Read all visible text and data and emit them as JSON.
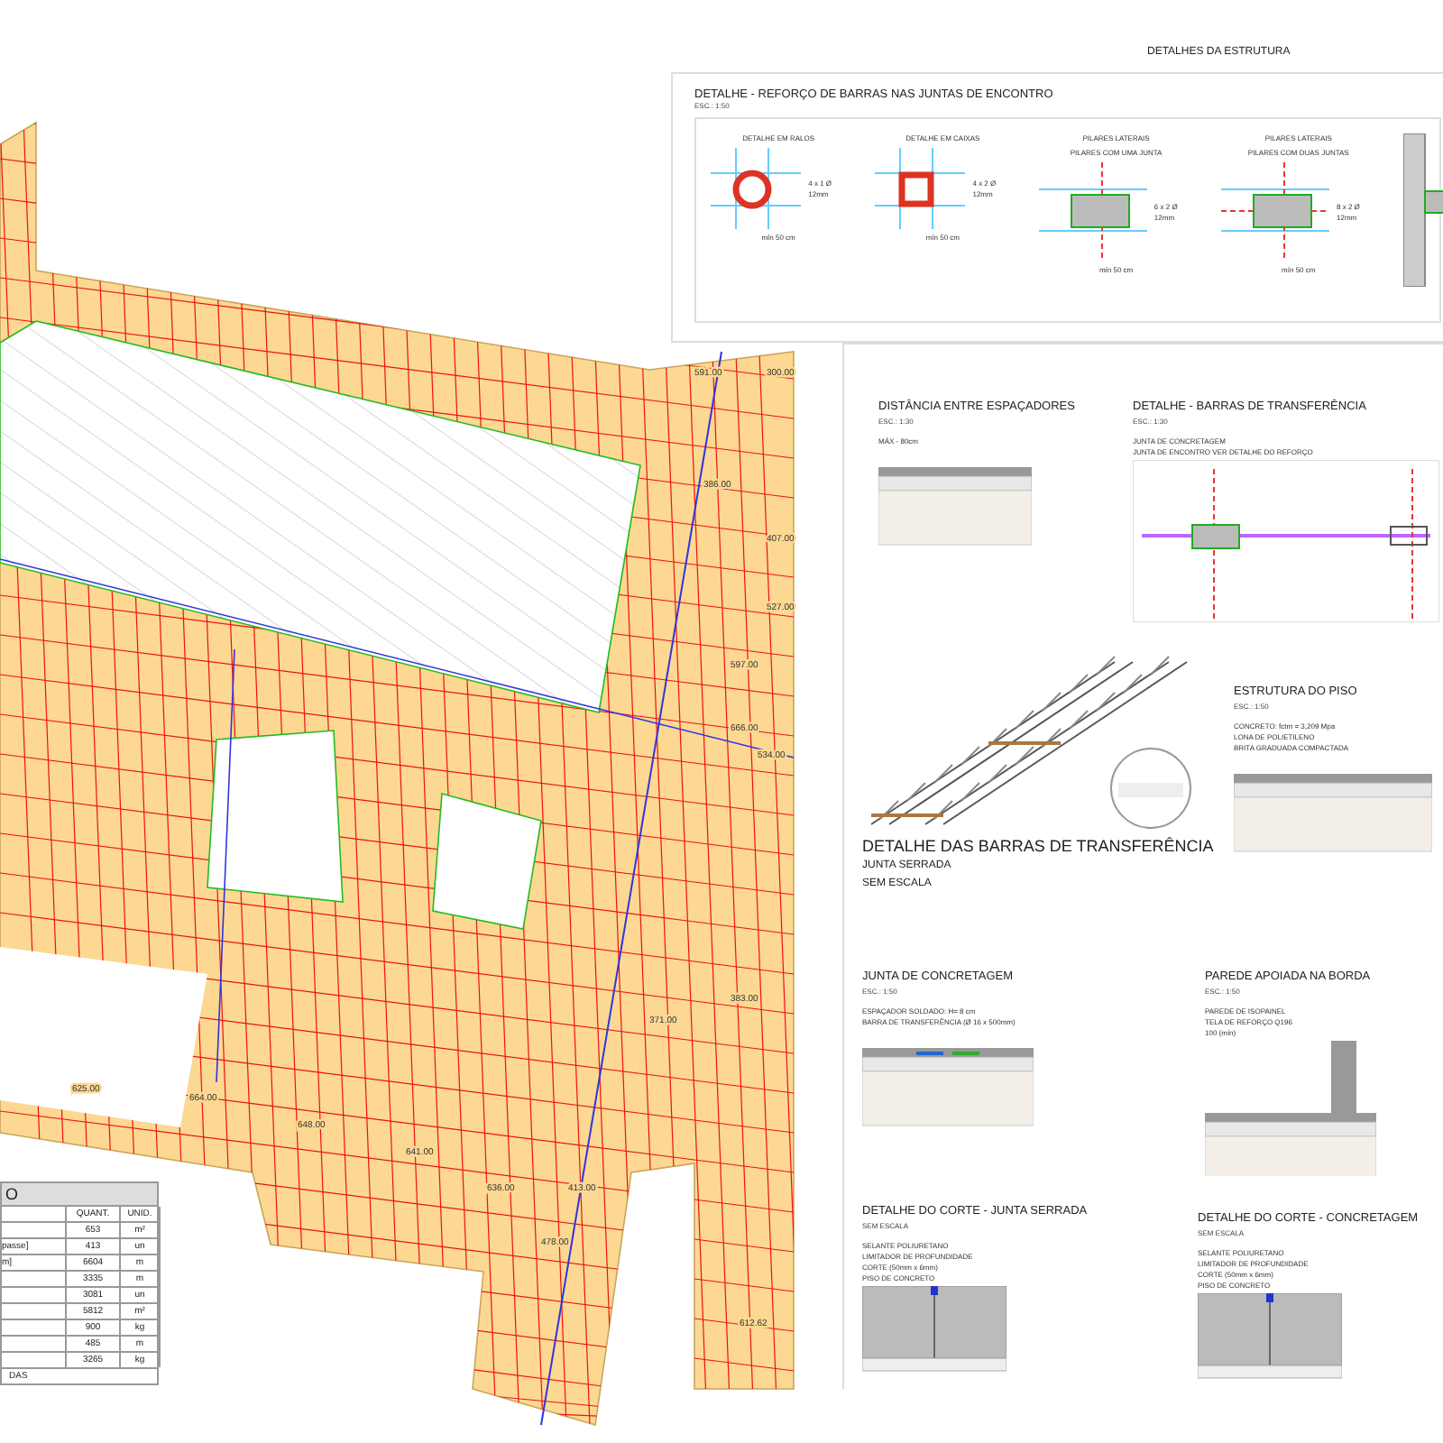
{
  "sheet_title": "DETALHES DA ESTRUTURA",
  "reinforcement": {
    "title": "DETALHE - REFORÇO DE BARRAS NAS JUNTAS DE ENCONTRO",
    "scale": "ESC.: 1:50",
    "details": [
      {
        "kind": "round",
        "label": "DETALHE EM RALOS",
        "note": "4 x 1 Ø 12mm",
        "dim": "mín 50 cm"
      },
      {
        "kind": "square",
        "label": "DETALHE EM CAIXAS",
        "note": "4 x 2 Ø 12mm",
        "dim": "mín 50 cm"
      },
      {
        "kind": "one_joint",
        "group": "PILARES LATERAIS",
        "label": "PILARES COM UMA JUNTA",
        "note": "6 x 2 Ø 12mm",
        "dim": "mín 50 cm"
      },
      {
        "kind": "two_joints",
        "group": "PILARES LATERAIS",
        "label": "PILARES COM DUAS JUNTAS",
        "note": "8 x 2 Ø 12mm",
        "dim": "mín 50 cm"
      },
      {
        "kind": "wall"
      }
    ]
  },
  "sections": [
    {
      "kind": "spacers",
      "title": "DISTÂNCIA ENTRE ESPAÇADORES",
      "scale": "ESC.: 1:30",
      "notes": [
        "MÁX - 80cm"
      ]
    },
    {
      "kind": "transfer",
      "title": "DETALHE - BARRAS DE TRANSFERÊNCIA",
      "scale": "ESC.: 1:30",
      "notes": [
        "JUNTA DE CONCRETAGEM",
        "JUNTA DE ENCONTRO VER DETALHE DO REFORÇO"
      ]
    },
    {
      "kind": "truss",
      "title": "DETALHE DAS BARRAS DE TRANSFERÊNCIA",
      "subtitles": [
        "JUNTA SERRADA",
        "SEM ESCALA"
      ]
    },
    {
      "kind": "floor",
      "title": "ESTRUTURA DO PISO",
      "scale": "ESC.: 1:50",
      "notes": [
        "CONCRETO: fctm = 3,209 Mpa",
        "LONA DE POLIETILENO",
        "BRITA GRADUADA COMPACTADA"
      ]
    },
    {
      "kind": "pour",
      "title": "JUNTA DE CONCRETAGEM",
      "scale": "ESC.: 1:50",
      "notes": [
        "ESPAÇADOR SOLDADO: H= 8 cm",
        "BARRA DE TRANSFERÊNCIA (Ø 16 x 500mm)"
      ]
    },
    {
      "kind": "wall",
      "title": "PAREDE APOIADA NA BORDA",
      "scale": "ESC.: 1:50",
      "notes": [
        "PAREDE DE ISOPAINEL",
        "TELA DE REFORÇO Q196",
        "100 (mín)"
      ]
    },
    {
      "kind": "cut",
      "title": "DETALHE DO CORTE - JUNTA SERRADA",
      "scale": "SEM ESCALA",
      "notes": [
        "SELANTE POLIURETANO",
        "LIMITADOR DE PROFUNDIDADE",
        "CORTE (50mm x 6mm)",
        "PISO DE CONCRETO"
      ]
    },
    {
      "kind": "cut",
      "title": "DETALHE DO CORTE - CONCRETAGEM",
      "scale": "SEM ESCALA",
      "notes": [
        "SELANTE POLIURETANO",
        "LIMITADOR DE PROFUNDIDADE",
        "CORTE (50mm x 6mm)",
        "PISO DE CONCRETO"
      ]
    }
  ],
  "plan_labels": [
    "591.00",
    "300.00",
    "386.00",
    "407.00",
    "527.00",
    "597.00",
    "666.00",
    "534.00",
    "383.00",
    "371.00",
    "413.00",
    "478.00",
    "612.62",
    "625.00",
    "664.00",
    "648.00",
    "641.00",
    "636.00"
  ],
  "table": {
    "title": "O",
    "columns": [
      "QUANT.",
      "UNID."
    ],
    "rows": [
      {
        "quant": "653",
        "unit": "m²"
      },
      {
        "item": "passe]",
        "quant": "413",
        "unit": "un"
      },
      {
        "item": "m]",
        "quant": "6604",
        "unit": "m"
      },
      {
        "quant": "3335",
        "unit": "m"
      },
      {
        "quant": "3081",
        "unit": "un"
      },
      {
        "quant": "5812",
        "unit": "m²"
      },
      {
        "quant": "900",
        "unit": "kg"
      },
      {
        "quant": "485",
        "unit": "m"
      },
      {
        "quant": "3265",
        "unit": "kg"
      }
    ],
    "footer": "DAS"
  }
}
